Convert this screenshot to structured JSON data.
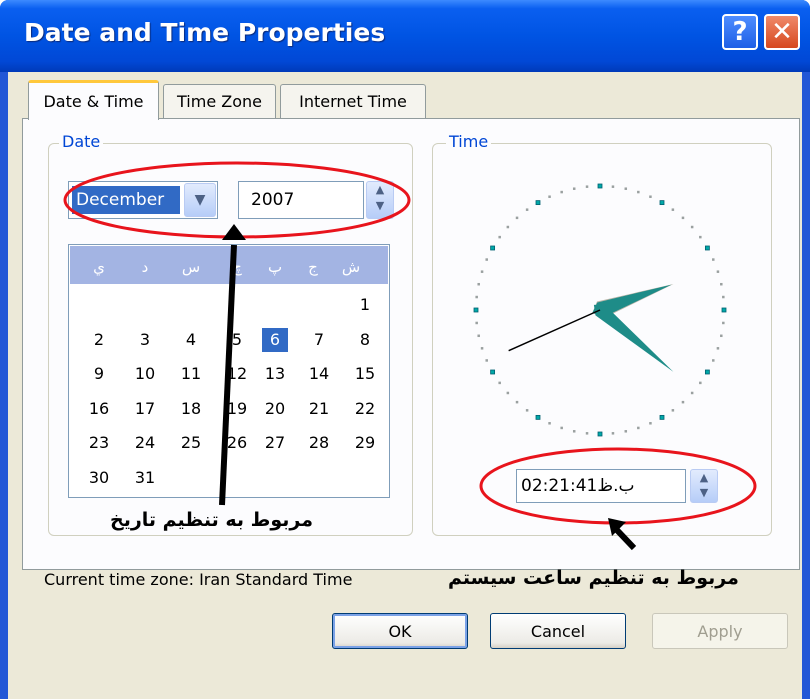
{
  "window": {
    "title": "Date and Time Properties",
    "help_glyph": "?",
    "close_glyph": "✕"
  },
  "tabs": [
    {
      "label": "Date & Time",
      "active": true
    },
    {
      "label": "Time Zone",
      "active": false
    },
    {
      "label": "Internet Time",
      "active": false
    }
  ],
  "date": {
    "group_label": "Date",
    "month": "December",
    "year": "2007",
    "weekdays": [
      "ش",
      "ج",
      "پ",
      "چ",
      "س",
      "د",
      "ي"
    ],
    "selected_day": "6",
    "weeks": [
      [
        "",
        "",
        "",
        "",
        "",
        "",
        "1"
      ],
      [
        "2",
        "3",
        "4",
        "5",
        "6",
        "7",
        "8"
      ],
      [
        "9",
        "10",
        "11",
        "12",
        "13",
        "14",
        "15"
      ],
      [
        "16",
        "17",
        "18",
        "19",
        "20",
        "21",
        "22"
      ],
      [
        "23",
        "24",
        "25",
        "26",
        "27",
        "28",
        "29"
      ],
      [
        "30",
        "31",
        "",
        "",
        "",
        "",
        ""
      ]
    ]
  },
  "time": {
    "group_label": "Time",
    "value": "02:21:41ب.ظ",
    "clock": {
      "hour": 2,
      "minute": 21,
      "second": 41
    }
  },
  "timezone": {
    "text": "Current time zone:  Iran Standard Time"
  },
  "annotations": {
    "date_note": "مربوط به تنظیم تاریخ",
    "time_note": "مربوط به تنظیم ساعت سیستم",
    "highlight_color": "#e8141c"
  },
  "buttons": {
    "ok": "OK",
    "cancel": "Cancel",
    "apply": "Apply"
  },
  "colors": {
    "titlebar": "#0054e3",
    "selection": "#316ac5",
    "calendar_header": "#a3b4e3",
    "clock_hands": "#1e8c88"
  }
}
